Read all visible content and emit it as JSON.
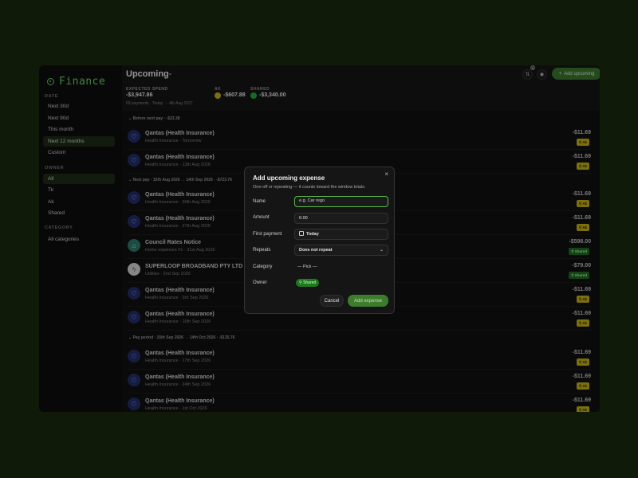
{
  "app": {
    "name": "Finance"
  },
  "sidebar": {
    "date_label": "DATE",
    "date_items": [
      "Next 30d",
      "Next 90d",
      "This month",
      "Next 12 months",
      "Custom"
    ],
    "owner_label": "OWNER",
    "owner_items": [
      "All",
      "Tk",
      "Ak",
      "Shared"
    ],
    "category_label": "CATEGORY",
    "category_items": [
      "All categories"
    ]
  },
  "header": {
    "title": "Upcoming",
    "expected_label": "EXPECTED SPEND",
    "expected_value": "-$3,947.86",
    "expected_sub": "69 payments · Today → 4th Aug 2027",
    "ak_label": "AK",
    "ak_value": "-$607.88",
    "shared_label": "SHARED",
    "shared_value": "-$3,340.00",
    "notification_count": "1",
    "add_label": "Add upcoming"
  },
  "groups": [
    {
      "label": "Before next pay · -$23.38"
    },
    {
      "label": "Next pay · 15th Aug 2026 → 14th Sep 2026 · -$723.76"
    },
    {
      "label": "Pay period · 15th Sep 2026 → 14th Oct 2026 · -$135.76"
    }
  ],
  "rows": [
    {
      "title": "Qantas (Health Insurance)",
      "sub": "Health Insurance · Tomorrow",
      "amount": "-$11.69",
      "badge": "Ak"
    },
    {
      "title": "Qantas (Health Insurance)",
      "sub": "Health Insurance · 13th Aug 2026",
      "amount": "-$11.69",
      "badge": "Ak"
    },
    {
      "title": "Qantas (Health Insurance)",
      "sub": "Health Insurance · 20th Aug 2026",
      "amount": "-$11.69",
      "badge": "Ak"
    },
    {
      "title": "Qantas (Health Insurance)",
      "sub": "Health Insurance · 27th Aug 2026",
      "amount": "-$11.69",
      "badge": "Ak"
    },
    {
      "title": "Council Rates Notice",
      "sub": "Home expenses #1 · 31st Aug 2026",
      "amount": "-$598.00",
      "badge": "Shared"
    },
    {
      "title": "SUPERLOOP BROADBAND PTY LTD",
      "sub": "Utilities · 2nd Sep 2026",
      "amount": "-$79.00",
      "badge": "Shared"
    },
    {
      "title": "Qantas (Health Insurance)",
      "sub": "Health Insurance · 3rd Sep 2026",
      "amount": "-$11.69",
      "badge": "Ak"
    },
    {
      "title": "Qantas (Health Insurance)",
      "sub": "Health Insurance · 10th Sep 2026",
      "amount": "-$11.69",
      "badge": "Ak"
    },
    {
      "title": "Qantas (Health Insurance)",
      "sub": "Health Insurance · 17th Sep 2026",
      "amount": "-$11.69",
      "badge": "Ak"
    },
    {
      "title": "Qantas (Health Insurance)",
      "sub": "Health Insurance · 24th Sep 2026",
      "amount": "-$11.69",
      "badge": "Ak"
    },
    {
      "title": "Qantas (Health Insurance)",
      "sub": "Health Insurance · 1st Oct 2026",
      "amount": "-$11.69",
      "badge": "Ak"
    }
  ],
  "modal": {
    "title": "Add upcoming expense",
    "subtitle": "One-off or repeating — it counts toward the window totals.",
    "name_label": "Name",
    "name_placeholder": "e.g. Car rego",
    "amount_label": "Amount",
    "amount_value": "0.00",
    "first_payment_label": "First payment",
    "first_payment_value": "Today",
    "repeats_label": "Repeats",
    "repeats_value": "Does not repeat",
    "category_label": "Category",
    "category_value": "— Pick —",
    "owner_label": "Owner",
    "owner_value": "Shared",
    "cancel_label": "Cancel",
    "submit_label": "Add expense",
    "close_glyph": "×"
  },
  "colors": {
    "accent": "#5cba49",
    "ak_badge": "#c9b417",
    "shared_badge": "#1d6e1f",
    "page_bg": "#0f1a08"
  }
}
